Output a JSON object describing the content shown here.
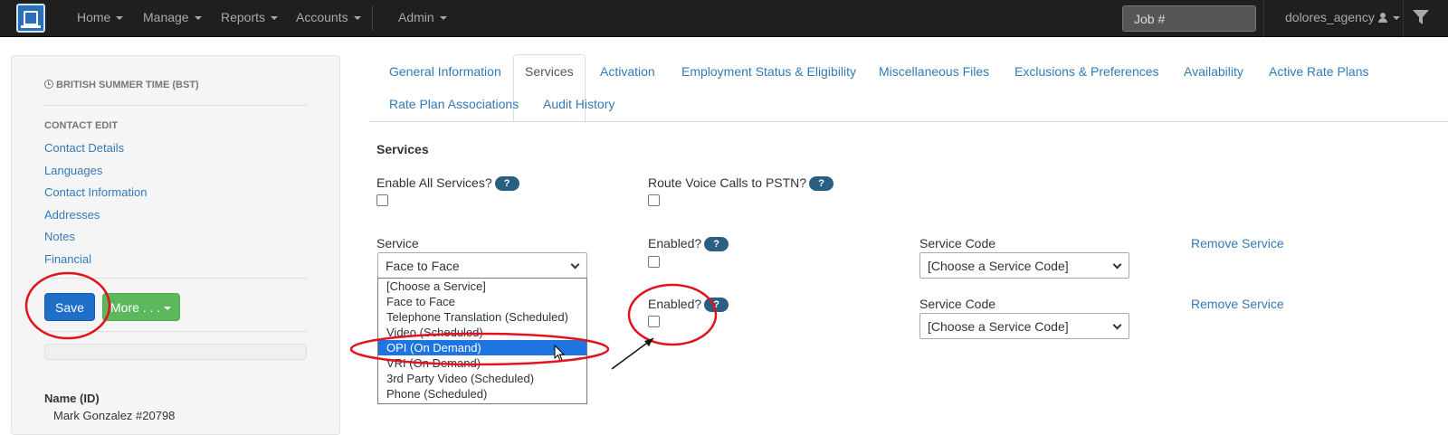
{
  "navbar": {
    "menu": [
      {
        "label": "Home"
      },
      {
        "label": "Manage"
      },
      {
        "label": "Reports"
      },
      {
        "label": "Accounts"
      },
      {
        "label": "Admin"
      }
    ],
    "job_placeholder": "Job #",
    "username": "dolores_agency"
  },
  "sidebar": {
    "timezone": "BRITISH SUMMER TIME (BST)",
    "section_heading": "CONTACT EDIT",
    "links": [
      {
        "label": "Contact Details"
      },
      {
        "label": "Languages"
      },
      {
        "label": "Contact Information"
      },
      {
        "label": "Addresses"
      },
      {
        "label": "Notes"
      },
      {
        "label": "Financial"
      }
    ],
    "save_label": "Save",
    "more_label": "More . . .",
    "name_label": "Name (ID)",
    "name_value": "Mark Gonzalez #20798"
  },
  "tabs": [
    {
      "label": "General Information"
    },
    {
      "label": "Services",
      "active": true
    },
    {
      "label": "Activation"
    },
    {
      "label": "Employment Status & Eligibility"
    },
    {
      "label": "Miscellaneous Files"
    },
    {
      "label": "Exclusions & Preferences"
    },
    {
      "label": "Availability"
    },
    {
      "label": "Active Rate Plans"
    },
    {
      "label": "Rate Plan Associations"
    },
    {
      "label": "Audit History"
    }
  ],
  "services": {
    "title": "Services",
    "enable_all_label": "Enable All Services?",
    "route_voice_label": "Route Voice Calls to PSTN?",
    "help_glyph": "?",
    "service_label": "Service",
    "enabled_label": "Enabled?",
    "service_code_label": "Service Code",
    "remove_label": "Remove Service",
    "row1_service_value": "Face to Face",
    "service_code_value": "[Choose a Service Code]",
    "dropdown_options": [
      {
        "label": "[Choose a Service]"
      },
      {
        "label": "Face to Face"
      },
      {
        "label": "Telephone Translation (Scheduled)"
      },
      {
        "label": "Video (Scheduled)"
      },
      {
        "label": "OPI (On Demand)",
        "highlighted": true
      },
      {
        "label": "VRI (On Demand)"
      },
      {
        "label": "3rd Party Video (Scheduled)"
      },
      {
        "label": "Phone (Scheduled)"
      }
    ]
  },
  "colors": {
    "accent_link": "#337ab7",
    "save_button": "#1f6fc9",
    "more_button": "#5cb85c",
    "annotation_red": "#e0141e",
    "selected_option": "#1e74e0"
  }
}
